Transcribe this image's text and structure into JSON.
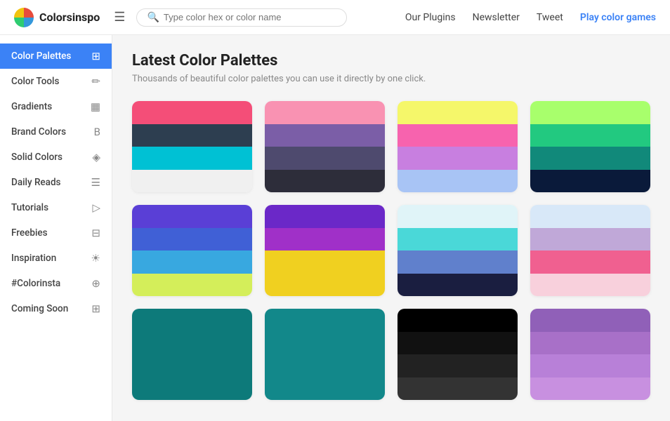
{
  "header": {
    "logo_text": "Colorsinspo",
    "search_placeholder": "Type color hex or color name",
    "nav": [
      {
        "label": "Our Plugins",
        "class": "normal"
      },
      {
        "label": "Newsletter",
        "class": "normal"
      },
      {
        "label": "Tweet",
        "class": "normal"
      },
      {
        "label": "Play color games",
        "class": "play"
      }
    ]
  },
  "sidebar": {
    "items": [
      {
        "label": "Color Palettes",
        "icon": "⊞",
        "active": true
      },
      {
        "label": "Color Tools",
        "icon": "✏",
        "active": false
      },
      {
        "label": "Gradients",
        "icon": "▦",
        "active": false
      },
      {
        "label": "Brand Colors",
        "icon": "B",
        "active": false
      },
      {
        "label": "Solid Colors",
        "icon": "◈",
        "active": false
      },
      {
        "label": "Daily Reads",
        "icon": "☰",
        "active": false
      },
      {
        "label": "Tutorials",
        "icon": "▷",
        "active": false
      },
      {
        "label": "Freebies",
        "icon": "⊟",
        "active": false
      },
      {
        "label": "Inspiration",
        "icon": "☀",
        "active": false
      },
      {
        "label": "#Colorinsta",
        "icon": "⊕",
        "active": false
      },
      {
        "label": "Coming Soon",
        "icon": "⊞",
        "active": false
      }
    ]
  },
  "main": {
    "title": "Latest Color Palettes",
    "subtitle": "Thousands of beautiful color palettes you can use it directly by one click.",
    "palettes": [
      {
        "colors": [
          "#F44E78",
          "#2D3E50",
          "#00C1D4",
          "#F0F0F0"
        ]
      },
      {
        "colors": [
          "#F992B2",
          "#7B5EA7",
          "#4E4A6E",
          "#2D2D3A"
        ]
      },
      {
        "colors": [
          "#F5F76A",
          "#F763AE",
          "#C87FE0",
          "#A8C4F5"
        ]
      },
      {
        "colors": [
          "#A8FF6C",
          "#22C980",
          "#11897A",
          "#0A1A3A"
        ]
      },
      {
        "colors": [
          "#5A3FD6",
          "#4060D6",
          "#38A8E0",
          "#D4EE5A"
        ]
      },
      {
        "colors": [
          "#6B28C8",
          "#A030C8",
          "#F0D020",
          "#F0D020"
        ]
      },
      {
        "colors": [
          "#E0F4F8",
          "#4AD8D8",
          "#6080CC",
          "#1A1E40"
        ]
      },
      {
        "colors": [
          "#D8E8F8",
          "#C0A8D8",
          "#F06090",
          "#F8D0DC"
        ]
      },
      {
        "colors": [
          "#0D7A7A",
          "#0D7A7A",
          "#0D7A7A",
          "#0D7A7A"
        ]
      },
      {
        "colors": [
          "#12888A",
          "#12888A",
          "#12888A",
          "#12888A"
        ]
      },
      {
        "colors": [
          "#000000",
          "#111111",
          "#222222",
          "#333333"
        ]
      },
      {
        "colors": [
          "#9060B8",
          "#A870C8",
          "#B880D8",
          "#C890E0"
        ]
      }
    ]
  }
}
